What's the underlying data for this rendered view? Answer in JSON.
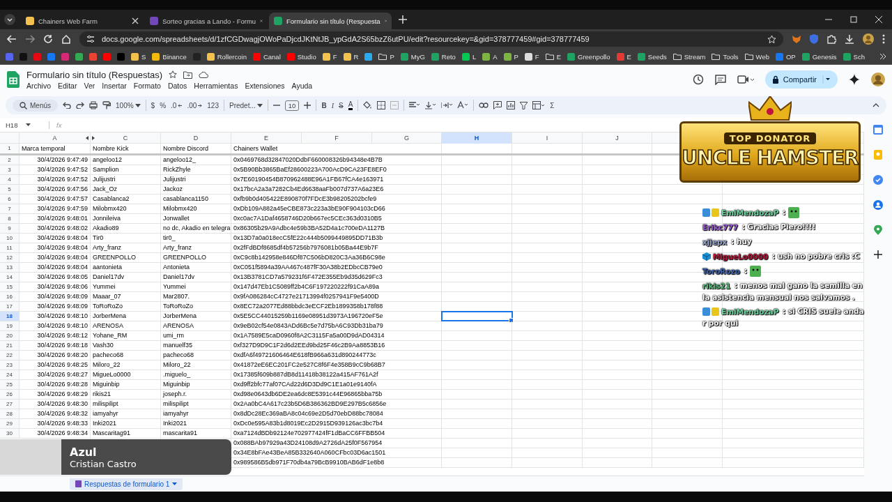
{
  "browser": {
    "tabs": [
      {
        "title": "Chainers Web Farm",
        "color": "#f2c14e",
        "selected": false
      },
      {
        "title": "Sorteo gracias a Lando - Formu",
        "color": "#7248b9",
        "selected": false
      },
      {
        "title": "Formulario sin título (Respuesta",
        "color": "#1ea362",
        "selected": true
      }
    ],
    "url": "docs.google.com/spreadsheets/d/1zfCGDwagjOWoPaDjcdJKtNtJB_ypGdA2S65bzZ6utPU/edit?resourcekey=&gid=378777459#gid=378777459",
    "bookmarks": [
      {
        "kind": "site",
        "color": "#5865f2"
      },
      {
        "kind": "site",
        "color": "#111111"
      },
      {
        "kind": "site",
        "color": "#e50914"
      },
      {
        "kind": "site",
        "color": "#1877f2"
      },
      {
        "kind": "site",
        "color": "#d62976"
      },
      {
        "kind": "site",
        "color": "#34a853"
      },
      {
        "kind": "site",
        "color": "#ea4335"
      },
      {
        "kind": "site",
        "color": "#ff0000"
      },
      {
        "kind": "site",
        "color": "#000000"
      },
      {
        "kind": "site",
        "label": "S",
        "color": "#f2c14e"
      },
      {
        "kind": "site",
        "label": "Binance",
        "color": "#f0b90b"
      },
      {
        "kind": "site",
        "color": "#222222"
      },
      {
        "kind": "site",
        "label": "Rollercoin",
        "color": "#f2c14e"
      },
      {
        "kind": "site",
        "label": "Canal",
        "color": "#ff0000"
      },
      {
        "kind": "site",
        "label": "Studio",
        "color": "#ff0000"
      },
      {
        "kind": "site",
        "label": "F",
        "color": "#f2c14e"
      },
      {
        "kind": "site",
        "label": "R",
        "color": "#f2c14e"
      },
      {
        "kind": "site",
        "color": "#2aabee"
      },
      {
        "kind": "folder",
        "label": "P"
      },
      {
        "kind": "site",
        "label": "MyG",
        "color": "#1ea362"
      },
      {
        "kind": "site",
        "label": "Reto",
        "color": "#1ea362"
      },
      {
        "kind": "site",
        "label": "L",
        "color": "#00c853"
      },
      {
        "kind": "site",
        "label": "A",
        "color": "#7cb342"
      },
      {
        "kind": "site",
        "label": "P",
        "color": "#7cb342"
      },
      {
        "kind": "site",
        "label": "F",
        "color": "#dddddd"
      },
      {
        "kind": "folder",
        "label": "E"
      },
      {
        "kind": "site",
        "label": "Greenpollo",
        "color": "#1ea362"
      },
      {
        "kind": "site",
        "label": "E",
        "color": "#e53935"
      },
      {
        "kind": "site",
        "label": "Seeds",
        "color": "#1ea362"
      },
      {
        "kind": "folder",
        "label": "Stream"
      },
      {
        "kind": "folder",
        "label": "Tools"
      },
      {
        "kind": "folder",
        "label": "Web"
      },
      {
        "kind": "site",
        "label": "OP",
        "color": "#1877f2"
      },
      {
        "kind": "site",
        "label": "Genesis",
        "color": "#1ea362"
      },
      {
        "kind": "site",
        "label": "Sch",
        "color": "#1ea362"
      }
    ]
  },
  "document": {
    "title": "Formulario sin título (Respuestas)",
    "menus": [
      "Archivo",
      "Editar",
      "Ver",
      "Insertar",
      "Formato",
      "Datos",
      "Herramientas",
      "Extensiones",
      "Ayuda"
    ],
    "share_button": "Compartir"
  },
  "toolbar": {
    "search": "Menús",
    "zoom": "100%",
    "currency": "$",
    "percent": "%",
    "decimal_less": ".0",
    "decimal_more": ".00",
    "number_format": "123",
    "font": "Predet...",
    "font_size": "10",
    "bold": "B",
    "italic": "I",
    "strikethrough": "S",
    "text_color": "A",
    "functions": "Σ"
  },
  "sheet": {
    "name_box": "H18",
    "fx": "fx",
    "columns": [
      {
        "letter": "A",
        "selected": false
      },
      {
        "letter": "C",
        "selected": false
      },
      {
        "letter": "D",
        "selected": false
      },
      {
        "letter": "E",
        "selected": false
      },
      {
        "letter": "F",
        "selected": false
      },
      {
        "letter": "G",
        "selected": false
      },
      {
        "letter": "H",
        "selected": true
      },
      {
        "letter": "I",
        "selected": false
      },
      {
        "letter": "J",
        "selected": false
      }
    ],
    "header_row": {
      "number": "1",
      "timestamp": "Marca temporal",
      "kick": "Nombre Kick",
      "discord": "Nombre Discord",
      "wallet": "Chainers Wallet"
    },
    "rows": [
      {
        "number": "2",
        "timestamp": "30/4/2026 9:47:49",
        "kick": "angeloo12",
        "discord": "angeloo12_",
        "wallet": "0x0469768d32847020DdbF660008326b94348e4B7B",
        "selected": false
      },
      {
        "number": "3",
        "timestamp": "30/4/2026 9:47:52",
        "kick": "Samplion",
        "discord": "RickZhyle",
        "wallet": "0x5B90Bb3865BaEf28600223A700AcD9CA23FE8EF0",
        "selected": false
      },
      {
        "number": "4",
        "timestamp": "30/4/2026 9:47:52",
        "kick": "Julijustri",
        "discord": "Julijustri",
        "wallet": "0x7E60190454B870962488E96A1FB67fCA4e163971",
        "selected": false
      },
      {
        "number": "5",
        "timestamp": "30/4/2026 9:47:56",
        "kick": "Jack_Oz",
        "discord": "Jackoz",
        "wallet": "0x17bcA2a3a7282Cb4Ed6638aaFb007d737A6a23E6",
        "selected": false
      },
      {
        "number": "6",
        "timestamp": "30/4/2026 9:47:57",
        "kick": "Casablanca2",
        "discord": "casablanca1150",
        "wallet": "0xfb9b0d405422E890870f7FDcE3b98205202bcfe9",
        "selected": false
      },
      {
        "number": "7",
        "timestamp": "30/4/2026 9:47:59",
        "kick": "Milobmx420",
        "discord": "Milobmx420",
        "wallet": "0xDb109A882a45eCBE873c223a3bE90F904103cD66",
        "selected": false
      },
      {
        "number": "8",
        "timestamp": "30/4/2026 9:48:01",
        "kick": "Jonnileiva",
        "discord": "Jonwallet",
        "wallet": "0xc0ac7A1Daf4658746D20b667ec5CEc363d0310B5",
        "selected": false
      },
      {
        "number": "9",
        "timestamp": "30/4/2026 9:48:02",
        "kick": "Akadio89",
        "discord": "no dc, Akadio en telegra",
        "wallet": "0x86305b29A9Adbc4e59b3BA52D4a1c700eDA1127B",
        "selected": false
      },
      {
        "number": "10",
        "timestamp": "30/4/2026 9:48:04",
        "kick": "Tir0",
        "discord": "tir0_",
        "wallet": "0x13D7a0a018ecC5fE22c444b5099449895DD71B3b",
        "selected": false
      },
      {
        "number": "11",
        "timestamp": "30/4/2026 9:48:04",
        "kick": "Arty_franz",
        "discord": "Arty_franz",
        "wallet": "0x2fFdBDf8685df4b57256b7976081b05Ba44E9b7F",
        "selected": false
      },
      {
        "number": "12",
        "timestamp": "30/4/2026 9:48:04",
        "kick": "GREENPOLLO",
        "discord": "GREENPOLLO",
        "wallet": "0xC9c8b142958e846Df87C506bD820C3Aa36B6C98e",
        "selected": false
      },
      {
        "number": "13",
        "timestamp": "30/4/2026 9:48:04",
        "kick": "aantonieta",
        "discord": "Antonieta",
        "wallet": "0xC051f5894a39AA467c487fF30A38b2EDbcCB79e0",
        "selected": false
      },
      {
        "number": "14",
        "timestamp": "30/4/2026 9:48:05",
        "kick": "Daniel17dv",
        "discord": "Daniel17dv",
        "wallet": "0x13B3781CD7a579231f6F472E355Eb9d35d629Fc3",
        "selected": false
      },
      {
        "number": "15",
        "timestamp": "30/4/2026 9:48:06",
        "kick": "Yummei",
        "discord": "Yummei",
        "wallet": "0x147d47Eb1C5089ff2b4C6F197220222f91CaA89a",
        "selected": false
      },
      {
        "number": "16",
        "timestamp": "30/4/2026 9:48:09",
        "kick": "Maaar_07",
        "discord": "Mar2807.",
        "wallet": "0x9fA086284cC4727e21713994f0257941F9e5400D",
        "selected": false
      },
      {
        "number": "17",
        "timestamp": "30/4/2026 9:48:09",
        "kick": "ToRoRoZo",
        "discord": "ToRoRoZo",
        "wallet": "0x8EC72a2077Ed88bbdc3eECF2Eb1899358b178f88",
        "selected": false
      },
      {
        "number": "18",
        "timestamp": "30/4/2026 9:48:10",
        "kick": "JorberMena",
        "discord": "JorberMena",
        "wallet": "0x5E5CC44015259b1169e08951d3973A196720eF5e",
        "selected": true
      },
      {
        "number": "19",
        "timestamp": "30/4/2026 9:48:10",
        "kick": "ARENOSA",
        "discord": "ARENOSA",
        "wallet": "0x9eB02cf54e0843ADd6Bc5e7d75bA6C93Db31ba79",
        "selected": false
      },
      {
        "number": "20",
        "timestamp": "30/4/2026 9:48:12",
        "kick": "Yohane_RM",
        "discord": "umi_rm",
        "wallet": "0x1A7589E5caD0960f8A2C3115Fa5a00D9dAD04314",
        "selected": false
      },
      {
        "number": "21",
        "timestamp": "30/4/2026 9:48:18",
        "kick": "Vash30",
        "discord": "manuelf35",
        "wallet": "0xf327D9D9C1F2d6d2EEd9bd25F46c2B9Aa8853B16",
        "selected": false
      },
      {
        "number": "22",
        "timestamp": "30/4/2026 9:48:20",
        "kick": "pacheco68",
        "discord": "pacheco68",
        "wallet": "0xdfA6f49721606464E618fB966a631d890244773c",
        "selected": false
      },
      {
        "number": "23",
        "timestamp": "30/4/2026 9:48:25",
        "kick": "Miloro_22",
        "discord": "Miloro_22",
        "wallet": "0x41872eE6EC201FC2e527C8f6F4e358B9cC9b68B7",
        "selected": false
      },
      {
        "number": "24",
        "timestamp": "30/4/2026 9:48:27",
        "kick": "MigueLo0000",
        "discord": ".miguelo_",
        "wallet": "0x17385f609b887dB8d11418b38122a415AF761A2f",
        "selected": false
      },
      {
        "number": "25",
        "timestamp": "30/4/2026 9:48:28",
        "kick": "Miguinbip",
        "discord": "Miguinbip",
        "wallet": "0xd9ff2bfc77af07CAd22d6D3Dd9C1E1a01e9140fA",
        "selected": false
      },
      {
        "number": "26",
        "timestamp": "30/4/2026 9:48:29",
        "kick": "rikis21",
        "discord": "joseph.r.",
        "wallet": "0xd98e0643db6DE2ea6dc8E5391c44E96865bba75b",
        "selected": false
      },
      {
        "number": "27",
        "timestamp": "30/4/2026 9:48:30",
        "kick": "milispilipt",
        "discord": "milispilipt",
        "wallet": "0x2Aa0bC4A617c23b5D6B386362BD9E297B5c6856e",
        "selected": false
      },
      {
        "number": "28",
        "timestamp": "30/4/2026 9:48:32",
        "kick": "iamyahyr",
        "discord": "iamyahyr",
        "wallet": "0x8dDc28Ec369aBA8c04c69e2D5d70ebD88bc78084",
        "selected": false
      },
      {
        "number": "29",
        "timestamp": "30/4/2026 9:48:33",
        "kick": "Inki2021",
        "discord": "Inki2021",
        "wallet": "0xDc0e595A83b1d8019Ec2D2915D939126ac3bc7b4",
        "selected": false
      },
      {
        "number": "30",
        "timestamp": "30/4/2026 9:48:34",
        "kick": "Mascaritag91",
        "discord": "mascarita91",
        "wallet": "0xa7124dBDb92124e702977424fF1dBaCC6FFBB504",
        "selected": false
      },
      {
        "wallet": "0x088BAb97929a43D24108d9A2726dA25f0F567954"
      },
      {
        "wallet": "0x34E8bFAe43BeA85B332640A060CFbc03D6ac1501"
      },
      {
        "wallet": "0x989586B5db971F70db4a79BcB9910BAB6dF1e8b8"
      }
    ],
    "sheet_tab": "Respuestas de formulario 1"
  },
  "stream": {
    "banner": {
      "subtitle": "TOP DONATOR",
      "name": "UNCLE HAMSTER"
    },
    "chat": [
      {
        "kind": "badged",
        "user": "EmiMendozaP",
        "color": "#6fd3a0",
        "text": ":",
        "emote": true
      },
      {
        "kind": "plain",
        "user": "Erikc777",
        "color": "#9b5bd4",
        "text": ": Gracias Piero!!!!",
        "emote": false
      },
      {
        "kind": "plain",
        "user": "xjjepx",
        "color": "#98a6c9",
        "text": ": huy",
        "emote": false
      },
      {
        "kind": "cube",
        "user": "MigueLo0000",
        "color": "#b3163a",
        "text": ": ush no pobre cris :C",
        "emote": false
      },
      {
        "kind": "plain",
        "user": "ToroRozo",
        "color": "#3d62ad",
        "text": ":",
        "emote": true
      },
      {
        "kind": "plain",
        "user": "rikis21",
        "color": "#5cbc7e",
        "text": ": menos mal gano la semilla en la asistencia mensual nos salvamos .",
        "emote": false
      },
      {
        "kind": "badged",
        "user": "EmiMendozaP",
        "color": "#6fd3a0",
        "text": ": si CRIS suele anda r por qui",
        "emote": false
      }
    ],
    "now_playing": {
      "song": "Azul",
      "artist": "Cristian Castro"
    }
  }
}
